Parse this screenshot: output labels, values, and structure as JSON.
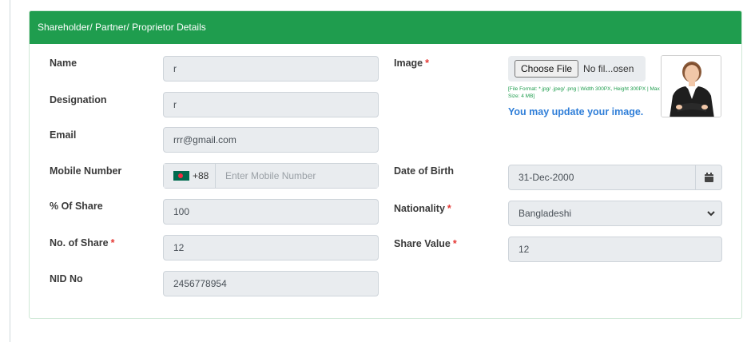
{
  "section": {
    "title": "Shareholder/ Partner/ Proprietor Details"
  },
  "left": {
    "name": {
      "label": "Name",
      "value": "r"
    },
    "designation": {
      "label": "Designation",
      "value": "r"
    },
    "email": {
      "label": "Email",
      "value": "rrr@gmail.com"
    },
    "mobile": {
      "label": "Mobile Number",
      "prefix": "+88",
      "placeholder": "Enter Mobile Number"
    },
    "share_percent": {
      "label": "% Of Share",
      "value": "100"
    },
    "no_of_share": {
      "label": "No. of Share",
      "required": "*",
      "value": "12"
    },
    "nid": {
      "label": "NID No",
      "value": "2456778954"
    }
  },
  "right": {
    "image": {
      "label": "Image",
      "required": "*",
      "choose_button": "Choose File",
      "file_name": "No fil...osen",
      "hint": "[File Format: *.jpg/ .jpeg/ .png | Width 300PX, Height 300PX | Max Size: 4 MB]",
      "update_text": "You may update your image."
    },
    "dob": {
      "label": "Date of Birth",
      "value": "31-Dec-2000"
    },
    "nationality": {
      "label": "Nationality",
      "required": "*",
      "value": "Bangladeshi"
    },
    "share_value": {
      "label": "Share Value",
      "required": "*",
      "value": "12"
    }
  },
  "colors": {
    "header_green": "#1f9d4e",
    "link_blue": "#2f7ed8",
    "required_red": "#e53935"
  }
}
